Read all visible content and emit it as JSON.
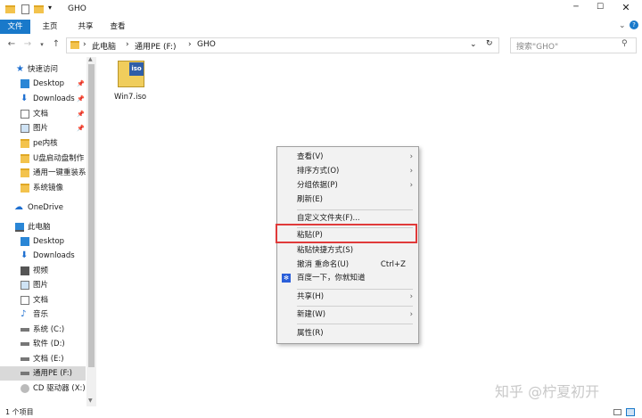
{
  "window": {
    "title": "GHO"
  },
  "ribbon": {
    "tabs": [
      "文件",
      "主页",
      "共享",
      "查看"
    ]
  },
  "address": {
    "crumbs": [
      "此电脑",
      "通用PE (F:)",
      "GHO"
    ],
    "search_placeholder": "搜索\"GHO\""
  },
  "nav": {
    "quick_access": "快速访问",
    "quick_items": [
      "Desktop",
      "Downloads",
      "文档",
      "图片",
      "pe内核",
      "U盘启动盘制作",
      "通用一键重装系",
      "系统镜像"
    ],
    "onedrive": "OneDrive",
    "this_pc": "此电脑",
    "pc_items": [
      "Desktop",
      "Downloads",
      "视频",
      "图片",
      "文档",
      "音乐",
      "系统 (C:)",
      "软件 (D:)",
      "文档 (E:)",
      "通用PE (F:)",
      "CD 驱动器 (X:)"
    ]
  },
  "files": [
    {
      "name": "Win7.iso",
      "icon_text": "iso"
    }
  ],
  "context_menu": {
    "view": "查看(V)",
    "sort": "排序方式(O)",
    "group": "分组依据(P)",
    "refresh": "刷新(E)",
    "customize": "自定义文件夹(F)...",
    "paste": "粘贴(P)",
    "paste_shortcut": "粘贴快捷方式(S)",
    "undo": "撤消 重命名(U)",
    "undo_shortcut": "Ctrl+Z",
    "baidu": "百度一下，你就知道",
    "share": "共享(H)",
    "new": "新建(W)",
    "properties": "属性(R)"
  },
  "status": {
    "count": "1 个项目"
  },
  "watermark": "知乎 @柠夏初开",
  "colors": {
    "accent": "#1979ca",
    "highlight_box": "#e03a3a",
    "folder": "#f3c34d"
  }
}
